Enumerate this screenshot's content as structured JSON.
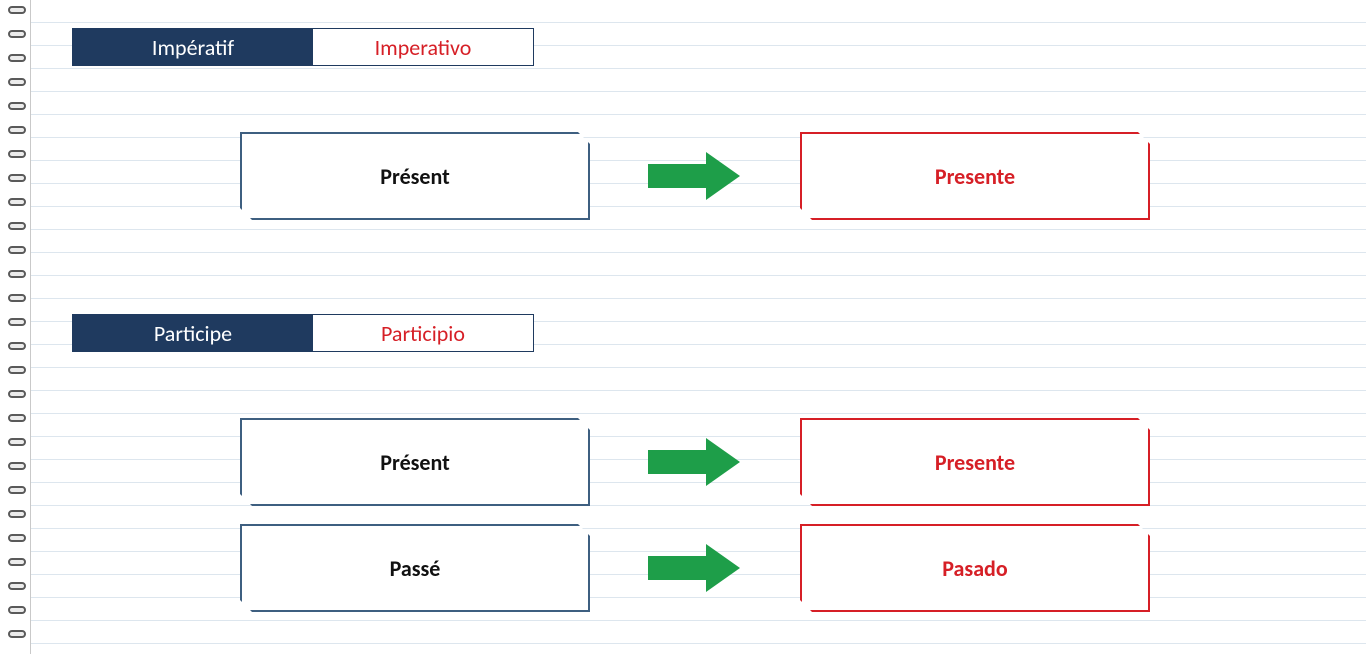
{
  "colors": {
    "header_dark_bg": "#1f3a5f",
    "accent_red": "#d61f26",
    "box_blue_border": "#3e5f80",
    "arrow_green": "#1e9e49"
  },
  "sections": [
    {
      "header": {
        "fr": "Impératif",
        "es": "Imperativo"
      },
      "rows": [
        {
          "fr": "Présent",
          "es": "Presente"
        }
      ]
    },
    {
      "header": {
        "fr": "Participe",
        "es": "Participio"
      },
      "rows": [
        {
          "fr": "Présent",
          "es": "Presente"
        },
        {
          "fr": "Passé",
          "es": "Pasado"
        }
      ]
    }
  ]
}
